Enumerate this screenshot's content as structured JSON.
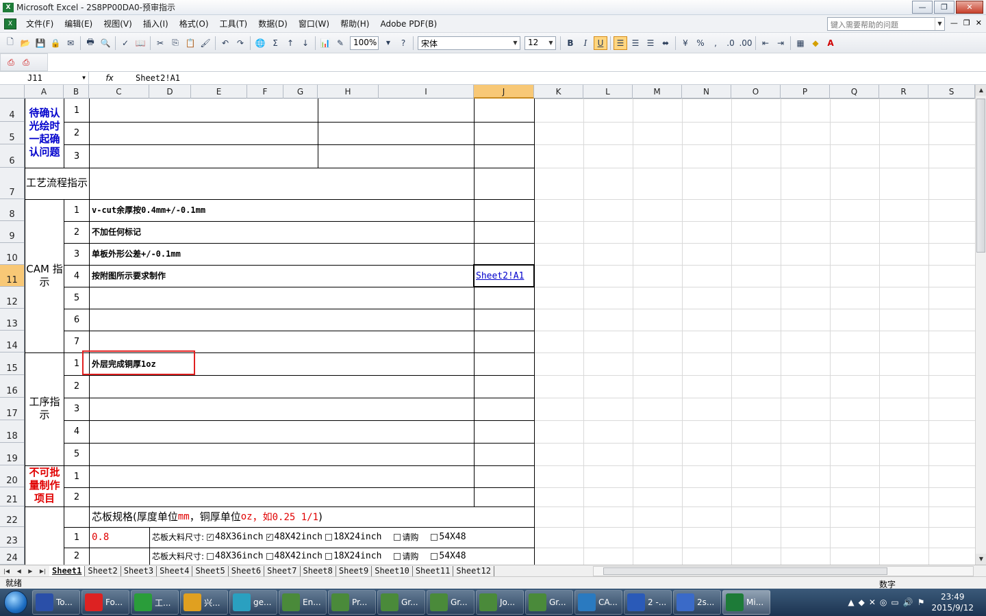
{
  "window": {
    "title": "Microsoft Excel - 2S8PP00DA0-预审指示"
  },
  "menu": [
    "文件(F)",
    "编辑(E)",
    "视图(V)",
    "插入(I)",
    "格式(O)",
    "工具(T)",
    "数据(D)",
    "窗口(W)",
    "帮助(H)",
    "Adobe PDF(B)"
  ],
  "help_box": {
    "placeholder": "键入需要帮助的问题"
  },
  "toolbar": {
    "zoom": "100%",
    "font": "宋体",
    "font_size": "12",
    "bold": "B",
    "italic": "I",
    "underline": "U"
  },
  "formula_bar": {
    "name_box": "J11",
    "fx": "fx",
    "content": "Sheet2!A1"
  },
  "columns": [
    "A",
    "B",
    "C",
    "D",
    "E",
    "F",
    "G",
    "H",
    "I",
    "J",
    "K",
    "L",
    "M",
    "N",
    "O",
    "P",
    "Q",
    "R",
    "S"
  ],
  "rows": [
    "4",
    "5",
    "6",
    "7",
    "8",
    "9",
    "10",
    "11",
    "12",
    "13",
    "14",
    "15",
    "16",
    "17",
    "18",
    "19",
    "20",
    "21",
    "22",
    "23",
    "24"
  ],
  "cells": {
    "a4_label": "待确认光绘时一起确认问题",
    "a7_label": "工艺流程指示",
    "a8_label": "CAM 指示",
    "a15_label": "工序指示",
    "a20_label": "不可批量制作项目",
    "b": [
      "1",
      "2",
      "3",
      "1",
      "2",
      "3",
      "4",
      "5",
      "6",
      "7",
      "1",
      "2",
      "3",
      "4",
      "5",
      "1",
      "2",
      "1",
      "2"
    ],
    "c8": "v-cut余厚按0.4mm+/-0.1mm",
    "c9": "不加任何标记",
    "c10": "单板外形公差+/-0.1mm",
    "c11": "按附图所示要求制作",
    "c15": "外层完成铜厚1oz",
    "j11": "Sheet2!A1",
    "r22_prefix": "芯板规格(厚度单位",
    "r22_mm": "mm",
    "r22_mid": "，铜厚单位",
    "r22_oz": "oz",
    "r22_comma": "，",
    "r22_example": "如0.25 1/1",
    "r22_suffix": ")",
    "c23": "0.8",
    "core_label": "芯板大料尺寸:",
    "options": [
      "48X36inch",
      "48X42inch",
      "18X24inch",
      "请购",
      "54X48"
    ]
  },
  "sheets": [
    "Sheet1",
    "Sheet2",
    "Sheet3",
    "Sheet4",
    "Sheet5",
    "Sheet6",
    "Sheet7",
    "Sheet8",
    "Sheet9",
    "Sheet10",
    "Sheet11",
    "Sheet12"
  ],
  "status": {
    "left": "就绪",
    "mode": "数字"
  },
  "taskbar": {
    "items": [
      "To...",
      "Fo...",
      "工...",
      "兴...",
      "ge...",
      "En...",
      "Pr...",
      "Gr...",
      "Gr...",
      "Jo...",
      "Gr...",
      "CA...",
      "2 -...",
      "2s...",
      "Mi..."
    ],
    "time": "23:49",
    "date": "2015/9/12"
  }
}
